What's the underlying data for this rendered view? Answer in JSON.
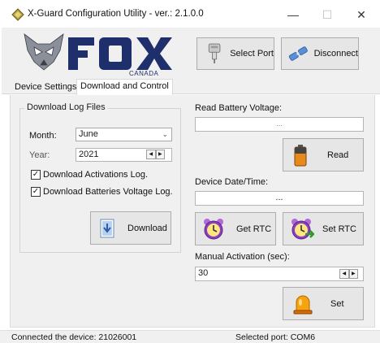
{
  "window": {
    "title": "X-Guard Configuration Utility - ver.: 2.1.0.0",
    "minimize": "—",
    "maximize": "☐",
    "close": "✕"
  },
  "header": {
    "logo_text": "FOX",
    "logo_sub": "CANADA",
    "select_port_label": "Select Port",
    "disconnect_label": "Disconnect"
  },
  "tabs": [
    {
      "label": "Device Settings",
      "active": false
    },
    {
      "label": "Download and Control",
      "active": true
    }
  ],
  "download_log": {
    "group_title": "Download Log Files",
    "month_label": "Month:",
    "month_value": "June",
    "year_label": "Year:",
    "year_value": "2021",
    "activations_label": "Download Activations Log.",
    "activations_checked": true,
    "batteries_label": "Download Batteries Voltage Log.",
    "batteries_checked": true,
    "download_button": "Download"
  },
  "battery": {
    "label": "Read Battery Voltage:",
    "value": "...",
    "read_button": "Read"
  },
  "datetime": {
    "label": "Device Date/Time:",
    "value": "...",
    "get_rtc_button": "Get RTC",
    "set_rtc_button": "Set RTC"
  },
  "manual": {
    "label": "Manual Activation (sec):",
    "value": "30",
    "set_button": "Set"
  },
  "status": {
    "connected": "Connected the device: 21026001",
    "port": "Selected port: COM6"
  },
  "colors": {
    "window_bg": "#f0f0f0",
    "button_bg": "#e6e6e6",
    "button_border": "#adadad",
    "logo_blue": "#1e2f6b"
  }
}
